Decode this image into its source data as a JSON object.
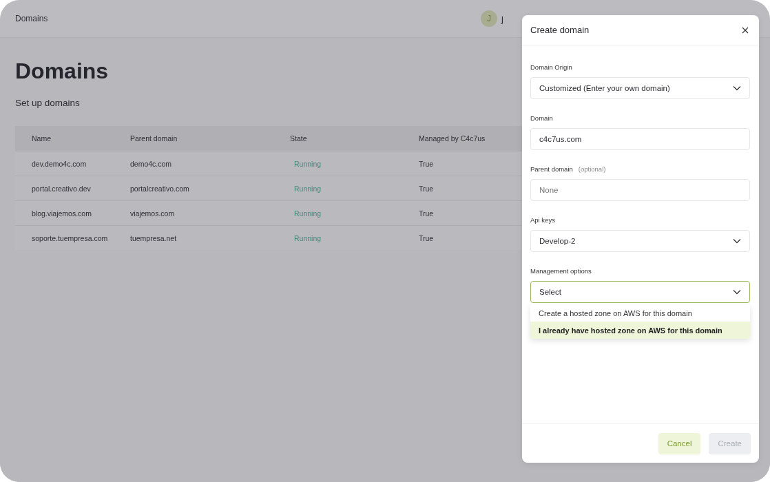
{
  "header": {
    "breadcrumb": "Domains",
    "avatar_initial": "J",
    "user_name": "j"
  },
  "page": {
    "title": "Domains",
    "subtitle": "Set up domains"
  },
  "table": {
    "columns": [
      "Name",
      "Parent domain",
      "State",
      "Managed by C4c7us"
    ],
    "rows": [
      {
        "name": "dev.demo4c.com",
        "parent": "demo4c.com",
        "state": "Running",
        "managed": "True"
      },
      {
        "name": "portal.creativo.dev",
        "parent": "portalcreativo.com",
        "state": "Running",
        "managed": "True"
      },
      {
        "name": "blog.viajemos.com",
        "parent": "viajemos.com",
        "state": "Running",
        "managed": "True"
      },
      {
        "name": "soporte.tuempresa.com",
        "parent": "tuempresa.net",
        "state": "Running",
        "managed": "True"
      }
    ]
  },
  "dialog": {
    "title": "Create domain",
    "fields": [
      {
        "kind": "select",
        "label": "Domain Origin",
        "value": "Customized (Enter your own domain)",
        "expanded": false
      },
      {
        "kind": "text",
        "label": "Domain",
        "value": "c4c7us.com"
      },
      {
        "kind": "text",
        "label": "Parent domain",
        "hint": "(optional)",
        "placeholder": "None"
      },
      {
        "kind": "select",
        "label": "Api keys",
        "value": "Develop-2",
        "expanded": false
      },
      {
        "kind": "select",
        "label": "Management options",
        "value": "Select",
        "expanded": true,
        "options": [
          {
            "label": "Create a hosted zone on AWS for this domain",
            "selected": false
          },
          {
            "label": "I already have hosted zone on AWS for this domain",
            "selected": true
          }
        ]
      }
    ],
    "buttons": [
      {
        "label": "Cancel",
        "disabled": false
      },
      {
        "label": "Create",
        "disabled": true
      }
    ]
  }
}
